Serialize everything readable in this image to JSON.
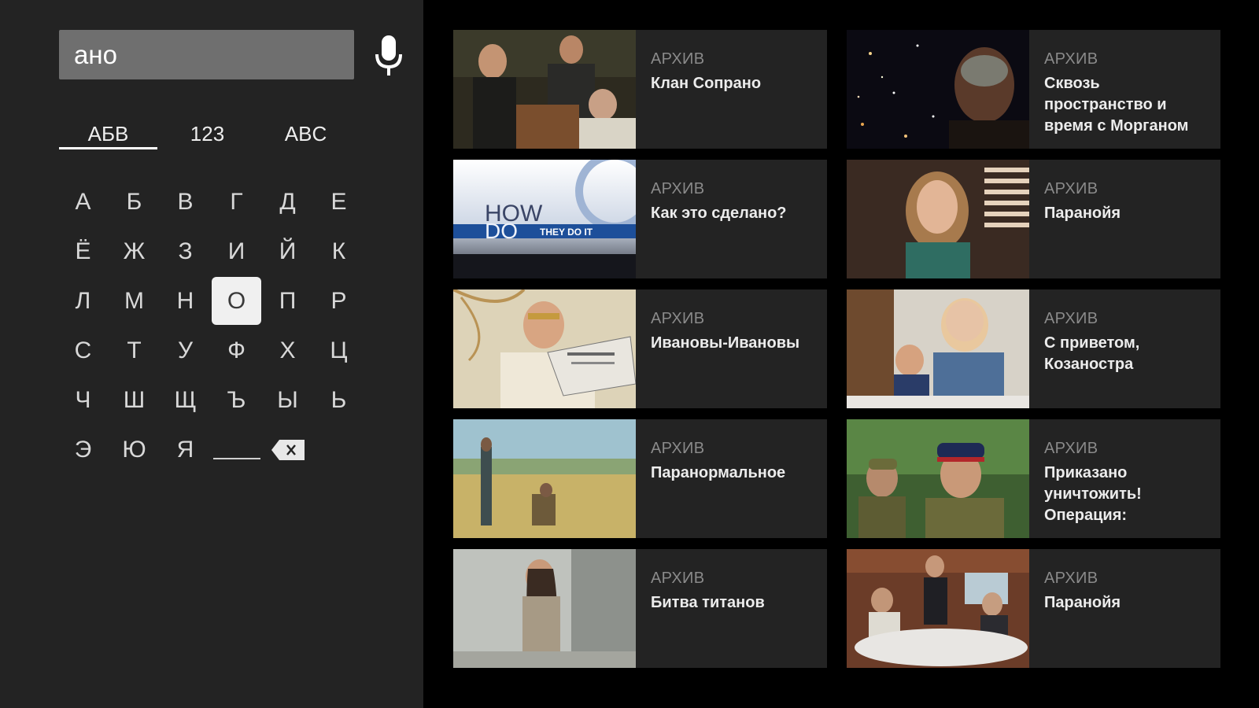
{
  "search": {
    "query": "ано"
  },
  "icons": {
    "mic": "microphone-icon",
    "backspace": "backspace-icon"
  },
  "keyboard": {
    "modes": [
      {
        "label": "АБВ",
        "active": true
      },
      {
        "label": "123",
        "active": false
      },
      {
        "label": "ABC",
        "active": false
      }
    ],
    "keys": [
      "А",
      "Б",
      "В",
      "Г",
      "Д",
      "Е",
      "Ё",
      "Ж",
      "З",
      "И",
      "Й",
      "К",
      "Л",
      "М",
      "Н",
      "О",
      "П",
      "Р",
      "С",
      "Т",
      "У",
      "Ф",
      "Х",
      "Ц",
      "Ч",
      "Ш",
      "Щ",
      "Ъ",
      "Ы",
      "Ь",
      "Э",
      "Ю",
      "Я"
    ],
    "focused_key": "О"
  },
  "results": [
    {
      "label": "АРХИВ",
      "title": "Клан Сопрано"
    },
    {
      "label": "АРХИВ",
      "title": "Сквозь пространство и время с Морганом"
    },
    {
      "label": "АРХИВ",
      "title": "Как это сделано?"
    },
    {
      "label": "АРХИВ",
      "title": "Паранойя"
    },
    {
      "label": "АРХИВ",
      "title": "Ивановы-Ивановы"
    },
    {
      "label": "АРХИВ",
      "title": "С приветом, Козаностра"
    },
    {
      "label": "АРХИВ",
      "title": "Паранормальное"
    },
    {
      "label": "АРХИВ",
      "title": "Приказано уничтожить! Операция:"
    },
    {
      "label": "АРХИВ",
      "title": "Битва титанов"
    },
    {
      "label": "АРХИВ",
      "title": "Паранойя"
    }
  ],
  "thumbnail_text": {
    "how_do_line1": "HOW",
    "how_do_line2": "DO",
    "how_do_line3": "THEY DO IT"
  },
  "colors": {
    "panel": "#232323",
    "background": "#000000",
    "search_box": "#6f6f6f",
    "focused_key": "#f0f0f0"
  }
}
